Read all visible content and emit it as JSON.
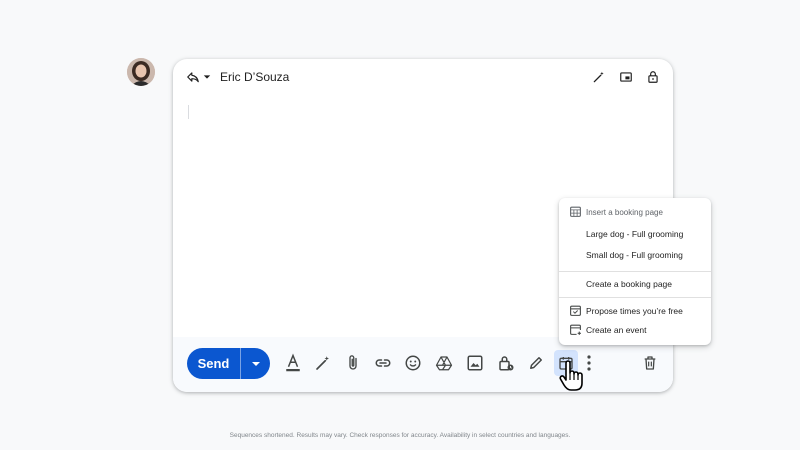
{
  "compose": {
    "recipient": "Eric D’Souza"
  },
  "send": {
    "label": "Send"
  },
  "menu": {
    "header": "Insert a booking page",
    "booking_pages": [
      "Large dog - Full grooming",
      "Small dog - Full grooming"
    ],
    "create_booking_page": "Create a booking page",
    "propose_times": "Propose times you’re free",
    "create_event": "Create an event"
  },
  "footer": {
    "disclaimer": "Sequences shortened. Results may vary. Check responses for accuracy. Availability in select countries and languages."
  },
  "colors": {
    "accent": "#0b57d0",
    "active_bg": "#d3e3fd",
    "icon": "#444746"
  }
}
